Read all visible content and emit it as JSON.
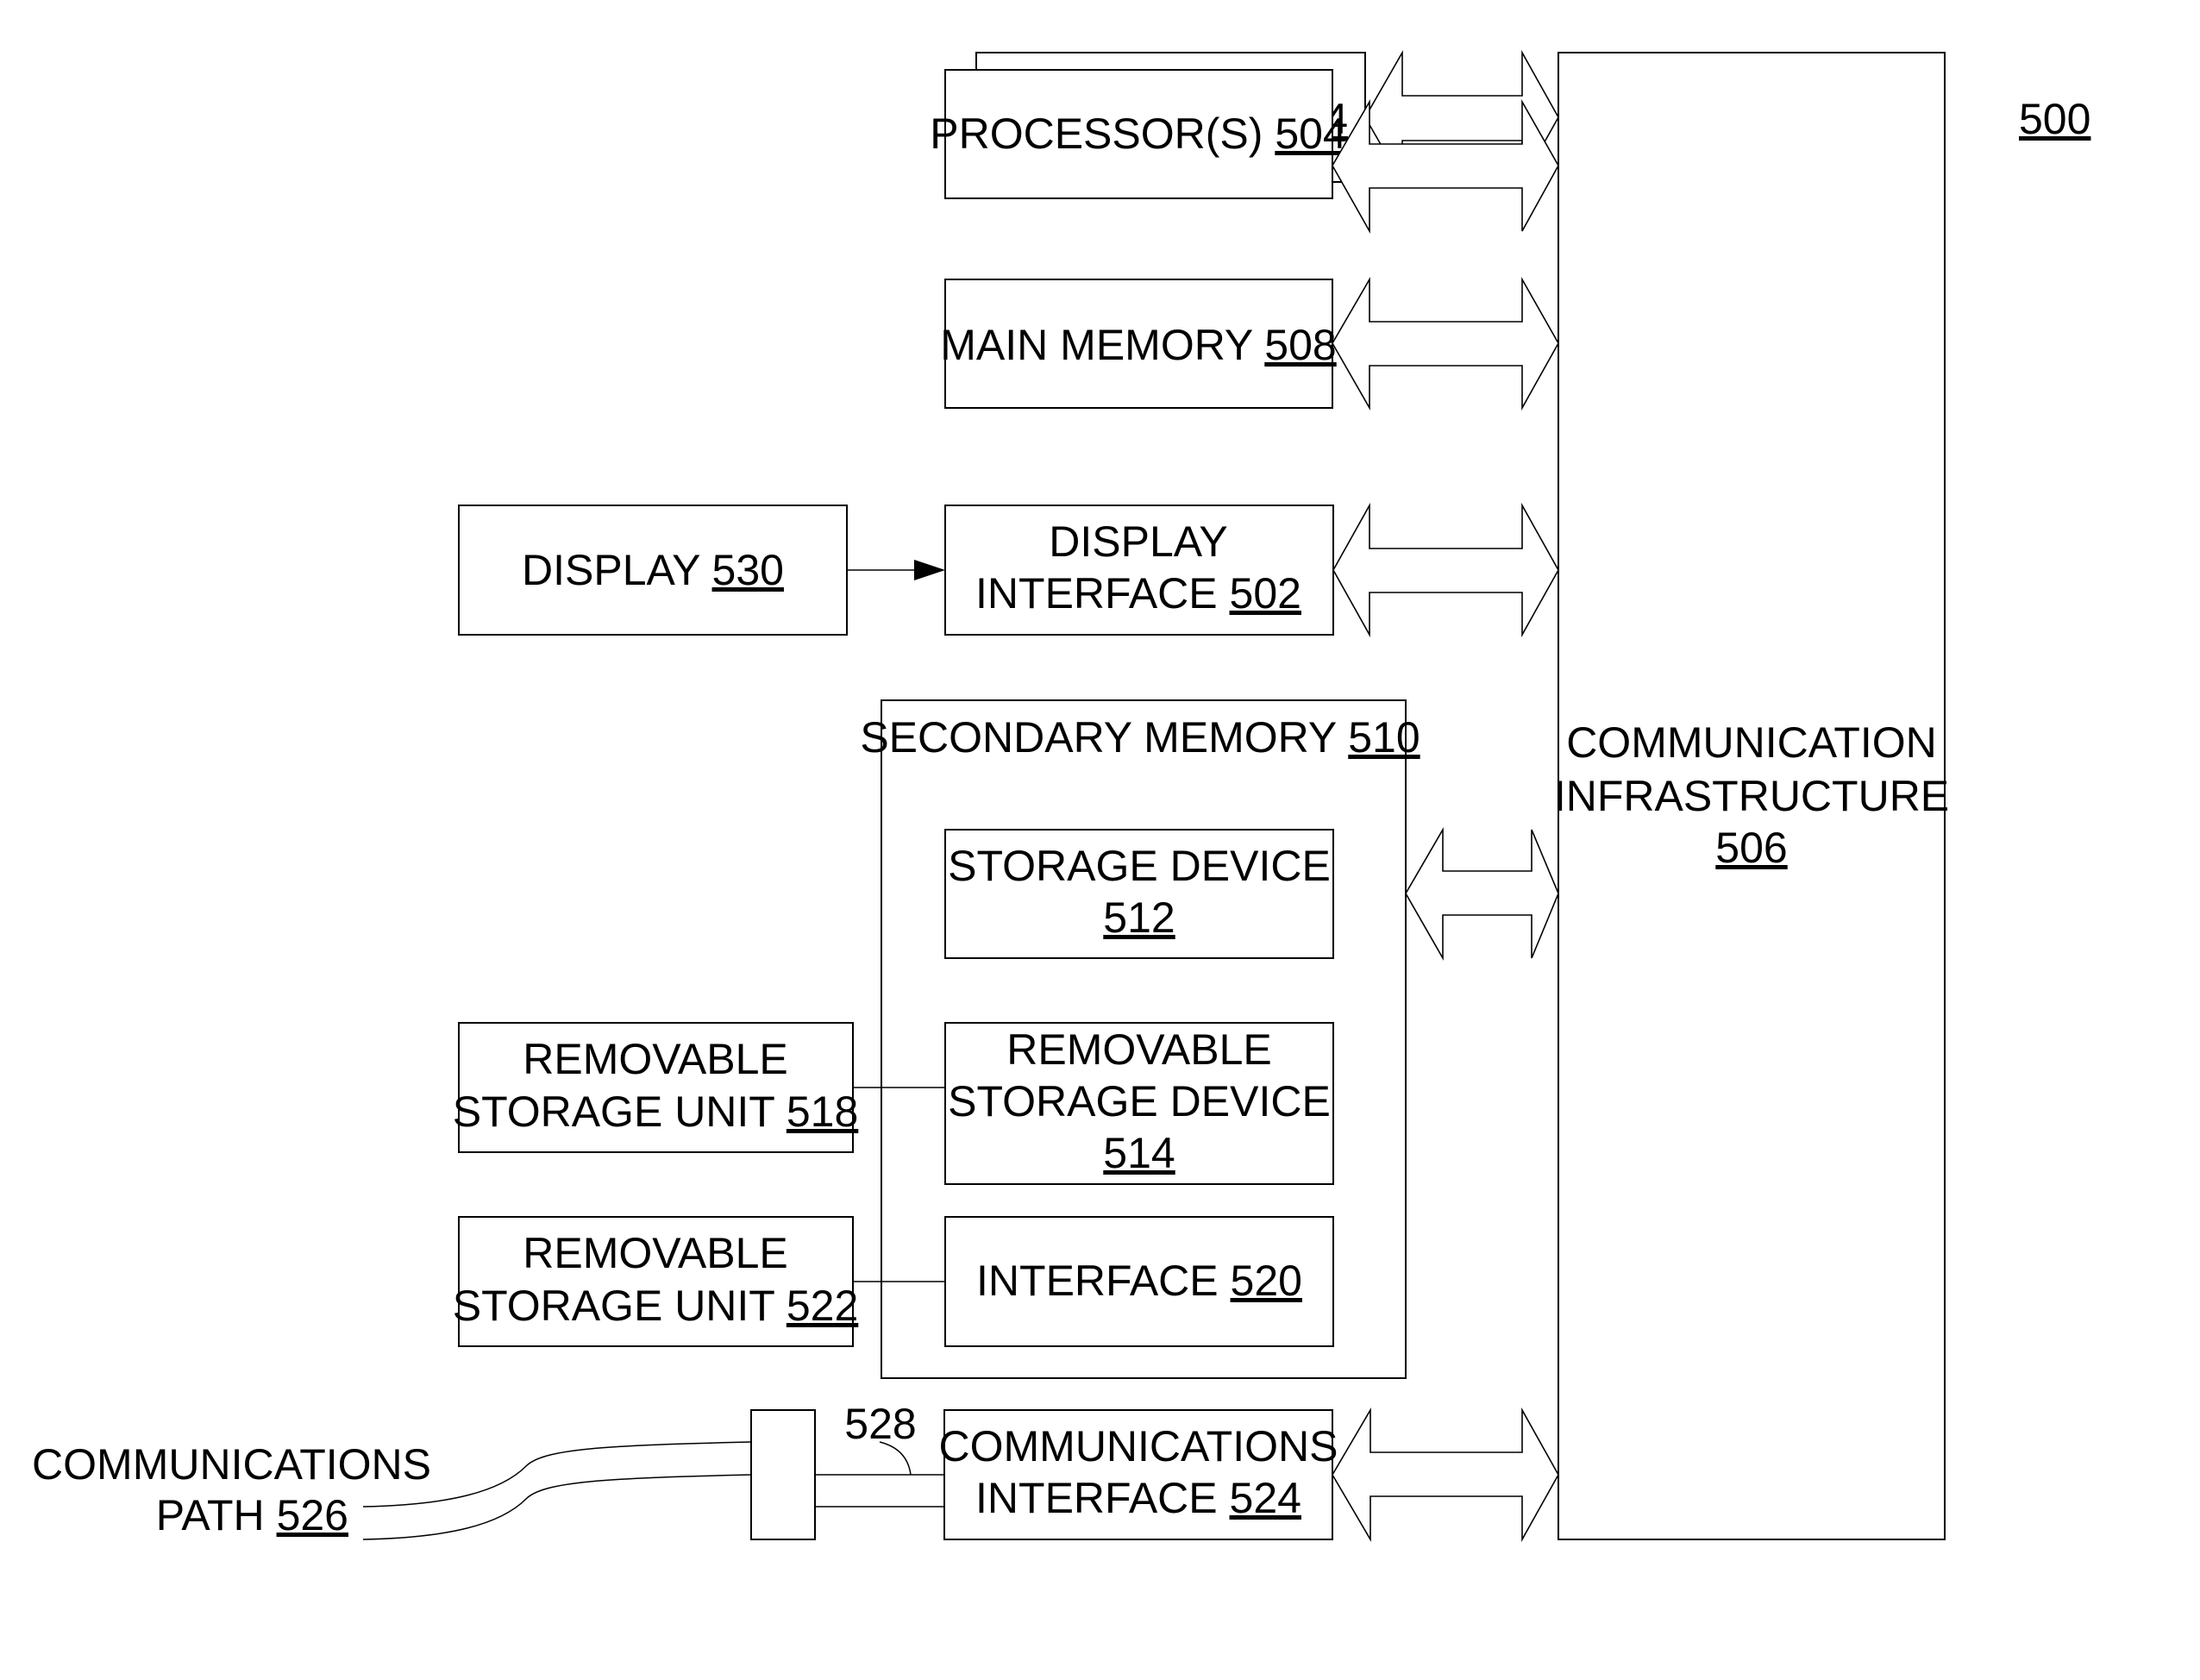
{
  "figure_ref": "500",
  "blocks": {
    "processor": {
      "text": "PROCESSOR(S)",
      "ref": "504"
    },
    "main_memory": {
      "text": "MAIN MEMORY",
      "ref": "508"
    },
    "display": {
      "text": "DISPLAY",
      "ref": "530"
    },
    "display_interface": {
      "line1": "DISPLAY",
      "text": "INTERFACE",
      "ref": "502"
    },
    "secondary_memory": {
      "text": "SECONDARY MEMORY",
      "ref": "510"
    },
    "storage_device": {
      "line1": "STORAGE DEVICE",
      "ref": "512"
    },
    "removable_storage_device": {
      "line1": "REMOVABLE",
      "line2": "STORAGE DEVICE",
      "ref": "514"
    },
    "interface": {
      "text": "INTERFACE",
      "ref": "520"
    },
    "removable_storage_unit_518": {
      "line1": "REMOVABLE",
      "text": "STORAGE UNIT",
      "ref": "518"
    },
    "removable_storage_unit_522": {
      "line1": "REMOVABLE",
      "text": "STORAGE UNIT",
      "ref": "522"
    },
    "communications_interface": {
      "line1": "COMMUNICATIONS",
      "text": "INTERFACE",
      "ref": "524"
    },
    "communication_infrastructure": {
      "line1": "COMMUNICATION",
      "line2": "INFRASTRUCTURE",
      "ref": "506"
    },
    "communications_path": {
      "line1": "COMMUNICATIONS",
      "text": "PATH",
      "ref": "526"
    },
    "connector_label": "528"
  }
}
